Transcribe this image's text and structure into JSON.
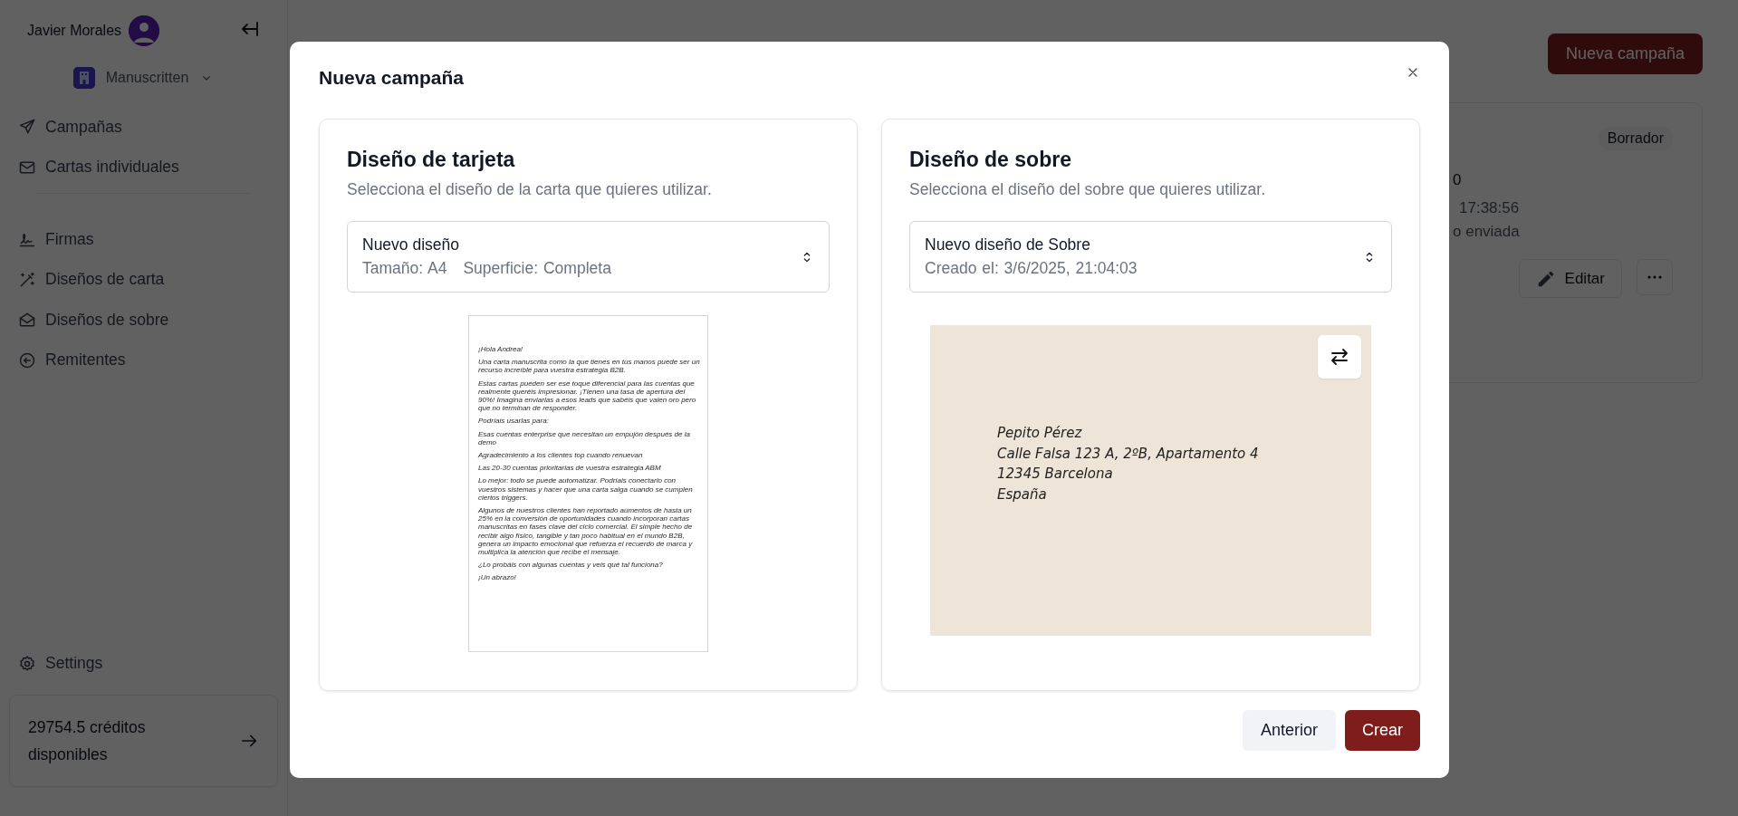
{
  "sidebar": {
    "user_name": "Javier Morales",
    "organization": "Manuscritten",
    "primary_nav": [
      "Campañas",
      "Cartas individuales"
    ],
    "secondary_nav": [
      "Firmas",
      "Diseños de carta",
      "Diseños de sobre",
      "Remitentes"
    ],
    "settings": "Settings",
    "credits": "29754.5 créditos disponibles"
  },
  "page": {
    "new_campaign_button": "Nueva campaña",
    "campaign_card": {
      "status": "Borrador",
      "count_fragment": "0",
      "date_fragment": "17:38:56",
      "sent_fragment": "o enviada",
      "edit_button": "Editar"
    }
  },
  "dialog": {
    "title": "Nueva campaña",
    "card_design": {
      "title": "Diseño de tarjeta",
      "subtitle": "Selecciona el diseño de la carta que quieres utilizar.",
      "select": {
        "name": "Nuevo diseño",
        "size": "Tamaño: A4",
        "surface": "Superficie: Completa"
      },
      "letter": [
        "¡Hola Andrea!",
        "Una carta manuscrita como la que tienes en tus manos puede ser un recurso increíble para vuestra estrategia B2B.",
        "Estas cartas pueden ser ese toque diferencial para las cuentas que realmente queréis impresionar. ¡Tienen una tasa de apertura del 90%! Imagina enviarlas a esos leads que sabéis que valen oro pero que no terminan de responder.",
        "Podríais usarlas para:",
        "Esas cuentas enterprise que necesitan un empujón después de la demo",
        "Agradecimiento a los clientes top cuando renuevan",
        "Las 20-30 cuentas prioritarias de vuestra estrategia ABM",
        "Lo mejor: todo se puede automatizar. Podríais conectarlo con vuestros sistemas y hacer que una carta salga cuando se cumplen ciertos triggers.",
        "Algunos de nuestros clientes han reportado aumentos de hasta un 25% en la conversión de oportunidades cuando incorporan cartas manuscritas en fases clave del ciclo comercial. El simple hecho de recibir algo físico, tangible y tan poco habitual en el mundo B2B, genera un impacto emocional que refuerza el recuerdo de marca y multiplica la atención que recibe el mensaje.",
        "¿Lo probáis con algunas cuentas y veis qué tal funciona?",
        "¡Un abrazo!"
      ]
    },
    "envelope_design": {
      "title": "Diseño de sobre",
      "subtitle": "Selecciona el diseño del sobre que quieres utilizar.",
      "select": {
        "name": "Nuevo diseño de Sobre",
        "created": "Creado el: 3/6/2025, 21:04:03"
      },
      "address": [
        "Pepito Pérez",
        "Calle Falsa 123 A, 2ºB, Apartamento 4",
        "12345 Barcelona",
        "España"
      ]
    },
    "buttons": [
      {
        "label": "Anterior",
        "kind": "secondary"
      },
      {
        "label": "Crear",
        "kind": "primary"
      }
    ]
  }
}
